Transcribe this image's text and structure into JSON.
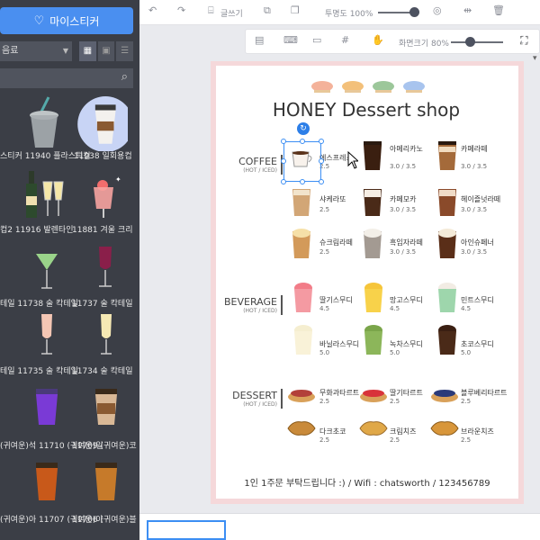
{
  "left_panel": {
    "sticker_button": "마이스티커",
    "category_value": "음료",
    "items": [
      {
        "label": "스티커 11940 플라스틱컵"
      },
      {
        "label": "11938 일회용컵"
      },
      {
        "label": "컵2 11916 발렌타인"
      },
      {
        "label": "11881 겨울 크리"
      },
      {
        "label": "테일 11738 술 칵테일"
      },
      {
        "label": "11737 술 칵테일"
      },
      {
        "label": "테일 11735 술 칵테일"
      },
      {
        "label": "11734 술 칵테일"
      },
      {
        "label": "(귀여운)석 11710 (귀여운)일"
      },
      {
        "label": "11709 (귀여운)코"
      },
      {
        "label": "(귀여운)아 11707 (귀여운)아"
      },
      {
        "label": "11706 (귀여운)블"
      }
    ]
  },
  "toolbar1": {
    "write_label": "글쓰기",
    "opacity_label": "투명도 100%",
    "opacity_value": 100
  },
  "toolbar2": {
    "zoom_label": "화면크기 80%",
    "zoom_value": 80
  },
  "menu": {
    "title": "HONEY Dessert shop",
    "sections": {
      "coffee": {
        "name": "COFFEE",
        "sub": "(HOT / ICED)"
      },
      "beverage": {
        "name": "BEVERAGE",
        "sub": "(HOT / ICED)"
      },
      "dessert": {
        "name": "DESSERT",
        "sub": "(HOT / ICED)"
      }
    },
    "items": [
      {
        "name": "에스프레소",
        "price": "2.5"
      },
      {
        "name": "아메리카노",
        "price": "3.0 / 3.5"
      },
      {
        "name": "카페라떼",
        "price": "3.0 / 3.5"
      },
      {
        "name": "샤케라또",
        "price": "2.5"
      },
      {
        "name": "카페모카",
        "price": "3.0 / 3.5"
      },
      {
        "name": "헤이즐넛라떼",
        "price": "3.0 / 3.5"
      },
      {
        "name": "슈크림라떼",
        "price": "2.5"
      },
      {
        "name": "흑임자라떼",
        "price": "3.0 / 3.5"
      },
      {
        "name": "아인슈페너",
        "price": "3.0 / 3.5"
      },
      {
        "name": "딸기스무디",
        "price": "4.5"
      },
      {
        "name": "망고스무디",
        "price": "4.5"
      },
      {
        "name": "민트스무디",
        "price": "4.5"
      },
      {
        "name": "바닐라스무디",
        "price": "5.0"
      },
      {
        "name": "녹차스무디",
        "price": "5.0"
      },
      {
        "name": "초코스무디",
        "price": "5.0"
      },
      {
        "name": "무화과타르트",
        "price": "2.5"
      },
      {
        "name": "딸기타르트",
        "price": "2.5"
      },
      {
        "name": "블루베리타르트",
        "price": "2.5"
      },
      {
        "name": "다크초코",
        "price": "2.5"
      },
      {
        "name": "크림치즈",
        "price": "2.5"
      },
      {
        "name": "브라운치즈",
        "price": "2.5"
      }
    ],
    "footer": "1인 1주문 부탁드립니다 :)  /  Wifi : chatsworth / 123456789"
  },
  "icons": {
    "heart": "heart-icon",
    "search": "search-icon",
    "undo": "undo-icon",
    "redo": "redo-icon",
    "rotate": "rotate-icon"
  },
  "colors": {
    "accent": "#4a8ff0",
    "panel": "#3b3e46",
    "page_border": "#f5d8da"
  }
}
